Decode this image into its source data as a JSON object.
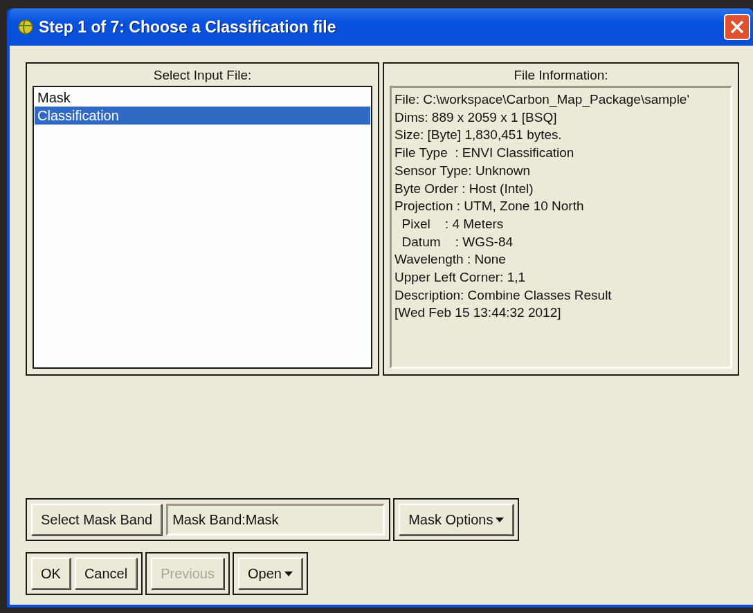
{
  "window": {
    "title": "Step 1 of 7: Choose a Classification file"
  },
  "input_files": {
    "label": "Select Input File:",
    "items": [
      {
        "label": "Mask",
        "selected": false
      },
      {
        "label": "Classification",
        "selected": true
      }
    ]
  },
  "file_information": {
    "label": "File Information:",
    "lines": [
      "File: C:\\workspace\\Carbon_Map_Package\\sample'",
      "Dims: 889 x 2059 x 1 [BSQ]",
      "Size: [Byte] 1,830,451 bytes.",
      "File Type  : ENVI Classification",
      "Sensor Type: Unknown",
      "Byte Order : Host (Intel)",
      "Projection : UTM, Zone 10 North",
      "  Pixel    : 4 Meters",
      "  Datum    : WGS-84",
      "Wavelength : None",
      "Upper Left Corner: 1,1",
      "Description: Combine Classes Result",
      "[Wed Feb 15 13:44:32 2012]"
    ]
  },
  "mask": {
    "button": "Select Mask Band",
    "value": "Mask Band:Mask",
    "options": "Mask Options"
  },
  "button_groups": [
    [
      {
        "label": "OK",
        "kind": "push",
        "disabled": false
      },
      {
        "label": "Cancel",
        "kind": "push",
        "disabled": false
      }
    ],
    [
      {
        "label": "Previous",
        "kind": "push",
        "disabled": true
      }
    ],
    [
      {
        "label": "Open",
        "kind": "menu",
        "disabled": false
      }
    ]
  ]
}
